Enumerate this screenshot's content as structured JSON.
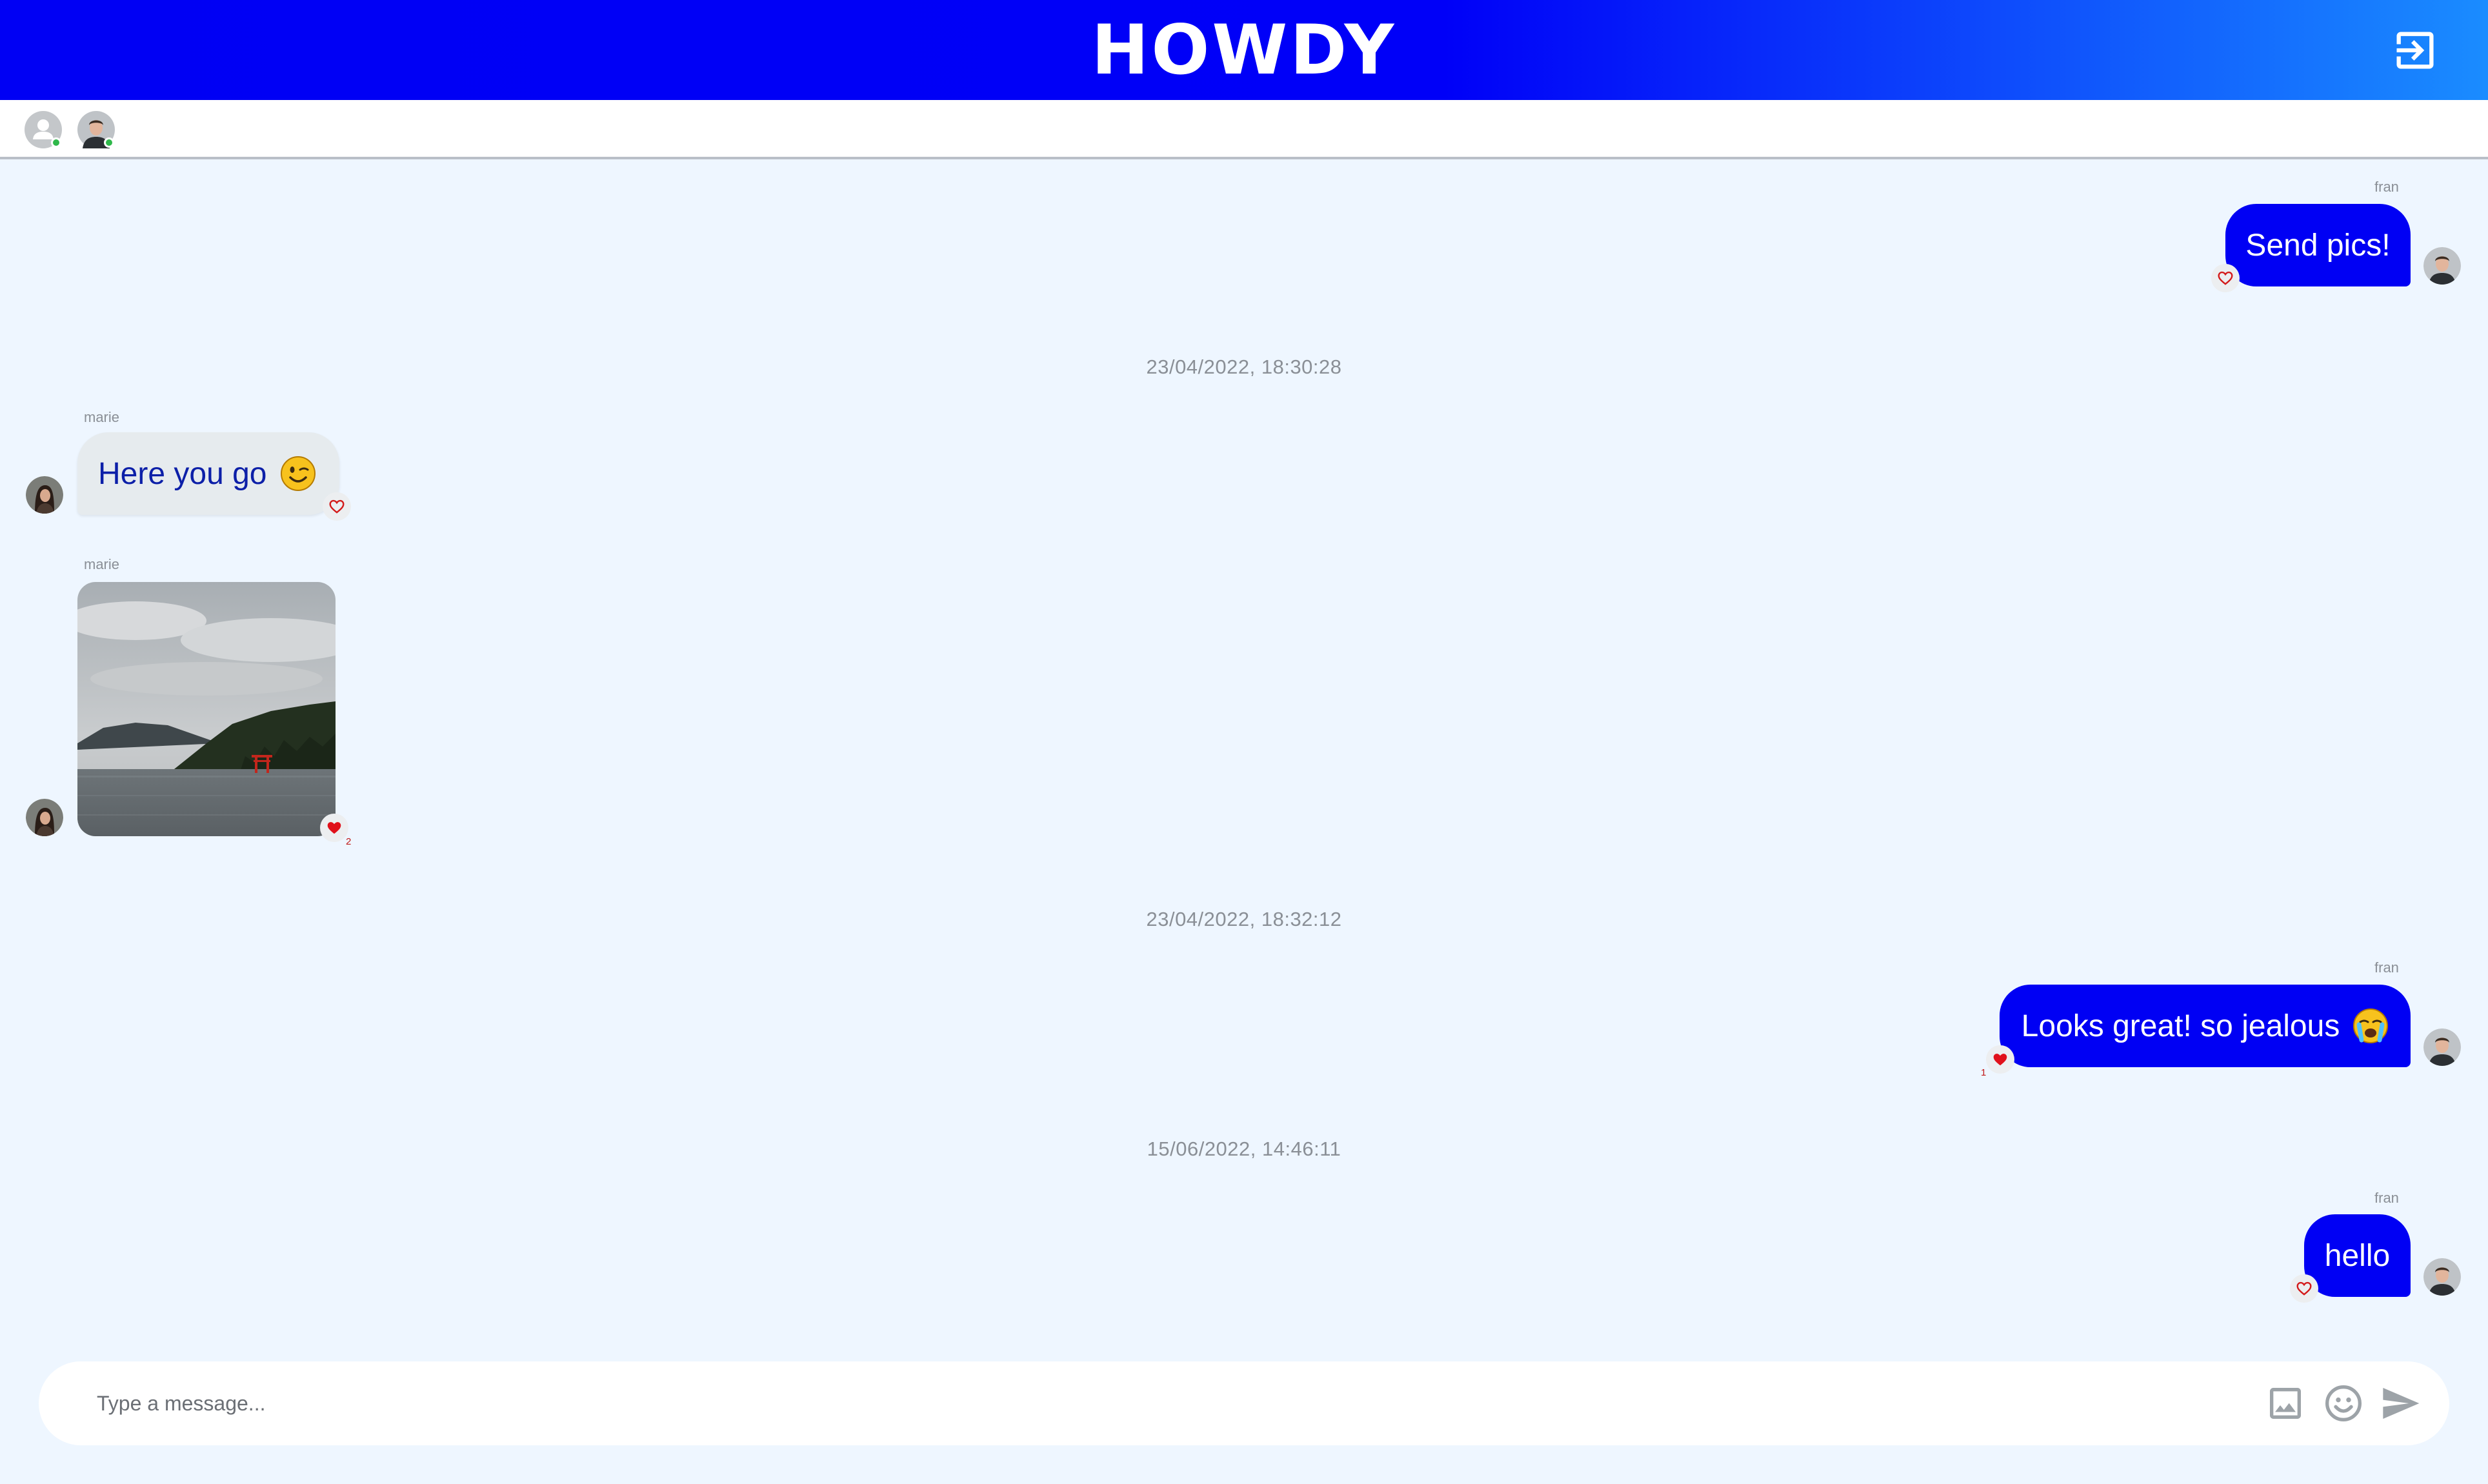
{
  "app": {
    "title": "HOWDY"
  },
  "header": {
    "logout_icon": "logout-icon"
  },
  "online_users": [
    {
      "avatar": "default-user-icon",
      "status_color": "#2fb84a"
    },
    {
      "avatar": "user-photo-fran",
      "status_color": "#2fb84a"
    }
  ],
  "messages": [
    {
      "sender": "fran",
      "text": "Send pics!",
      "direction": "outgoing",
      "liked": false
    },
    {
      "timestamp": "23/04/2022, 18:30:28"
    },
    {
      "sender": "marie",
      "text": "Here you go",
      "emoji": "winking-face",
      "direction": "incoming",
      "liked": false
    },
    {
      "sender": "marie",
      "type": "image",
      "image": "lake-photo",
      "direction": "incoming",
      "liked": true,
      "likes": "2"
    },
    {
      "timestamp": "23/04/2022, 18:32:12"
    },
    {
      "sender": "fran",
      "text": "Looks great! so jealous",
      "emoji": "crying-face",
      "direction": "outgoing",
      "liked": true,
      "likes": "1"
    },
    {
      "timestamp": "15/06/2022, 14:46:11"
    },
    {
      "sender": "fran",
      "text": "hello",
      "direction": "outgoing",
      "liked": false
    }
  ],
  "composer": {
    "placeholder": "Type a message...",
    "image_icon": "image-icon",
    "emoji_icon": "smiley-icon",
    "send_icon": "send-icon"
  },
  "colors": {
    "brand": "#0000f4",
    "background": "#eef6ff",
    "like": "#e0101a"
  }
}
